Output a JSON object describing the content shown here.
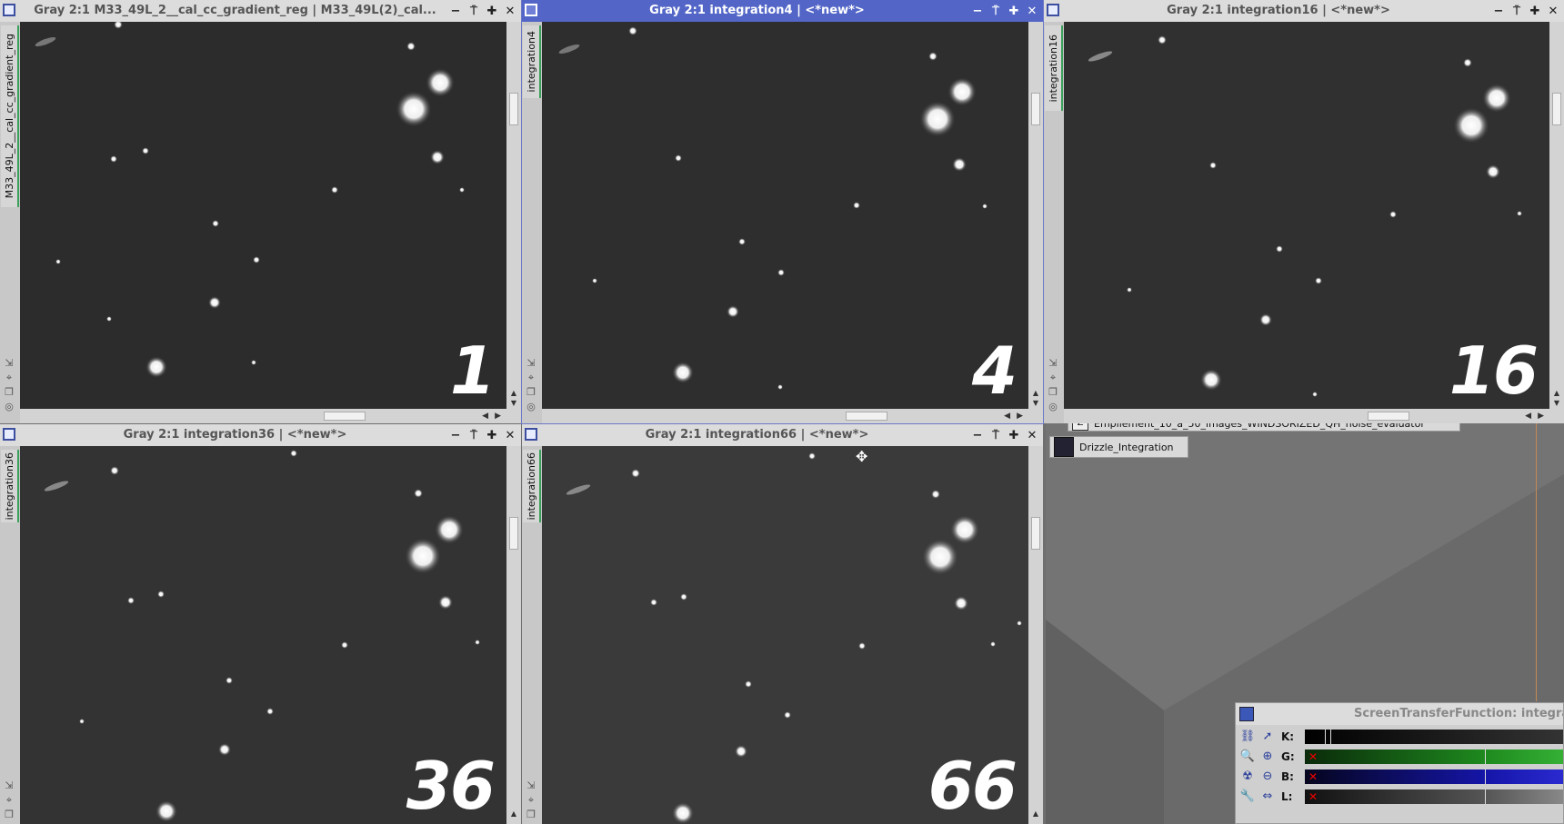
{
  "windows": [
    {
      "id": "w1",
      "title": "Gray 2:1 M33_49L_2__cal_cc_gradient_reg | M33_49L(2)_cal...",
      "vertical_tab": "M33_49L_2__cal_cc_gradient_reg",
      "overlay_number": "1",
      "active": false
    },
    {
      "id": "w2",
      "title": "Gray 2:1 integration4 | <*new*>",
      "vertical_tab": "integration4",
      "overlay_number": "4",
      "active": true
    },
    {
      "id": "w3",
      "title": "Gray 2:1 integration16 | <*new*>",
      "vertical_tab": "integration16",
      "overlay_number": "16",
      "active": false
    },
    {
      "id": "w4",
      "title": "Gray 2:1 integration36 | <*new*>",
      "vertical_tab": "integration36",
      "overlay_number": "36",
      "active": false
    },
    {
      "id": "w5",
      "title": "Gray 2:1 integration66 | <*new*>",
      "vertical_tab": "integration66",
      "overlay_number": "66",
      "active": false
    }
  ],
  "window_buttons": {
    "minimize": "−",
    "shade": "⍑",
    "maximize": "✚",
    "close": "✕"
  },
  "desktop_icons": [
    {
      "label": "Empilement_10_a_50_images_WINDSORIZED_QH_noise_evaluator",
      "icon": "process-icon-z"
    },
    {
      "label": "Drizzle_Integration",
      "icon": "process-icon-drizzle"
    }
  ],
  "stf": {
    "title": "ScreenTransferFunction: integratio",
    "rows": [
      {
        "label": "K:",
        "color": "#1c1c1c",
        "icon_left": "link-icon",
        "icon_right": "pointer-icon"
      },
      {
        "label": "G:",
        "color": "#1e8a1e",
        "icon_left": "zoom-icon",
        "icon_right": "zoom-in-icon"
      },
      {
        "label": "B:",
        "color": "#1515a8",
        "icon_left": "auto-stretch-icon",
        "icon_right": "zoom-out-icon"
      },
      {
        "label": "L:",
        "color": "#2a2a2a",
        "icon_left": "wrench-icon",
        "icon_right": "horizontal-arrows-icon"
      }
    ]
  },
  "colors": {
    "active_title": "#5366c7",
    "inactive_title": "#dcdcdc",
    "image_bg": "#2c2c2c"
  }
}
